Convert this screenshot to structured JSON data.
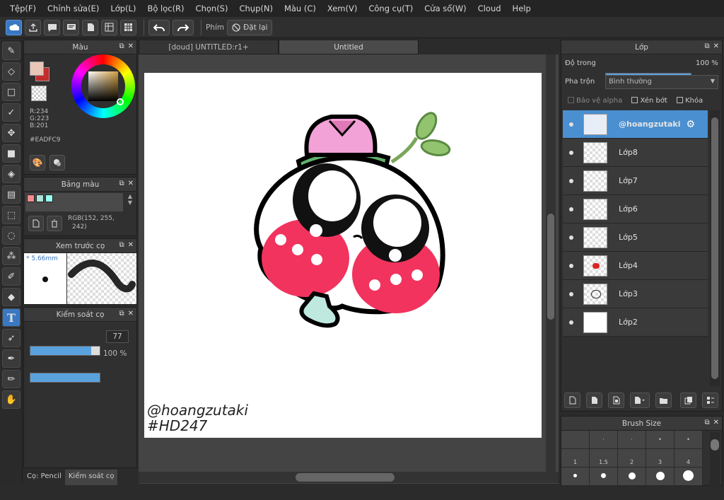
{
  "menu": [
    "Tệp(F)",
    "Chỉnh sửa(E)",
    "Lớp(L)",
    "Bộ lọc(R)",
    "Chọn(S)",
    "Chụp(N)",
    "Màu (C)",
    "Xem(V)",
    "Công cụ(T)",
    "Cửa sổ(W)",
    "Cloud",
    "Help"
  ],
  "toolbar": {
    "key_label": "Phím",
    "reset_label": "Đặt lại"
  },
  "color_panel": {
    "title": "Màu",
    "r": "R:234",
    "g": "G:223",
    "b": "B:201",
    "hex": "#EADFC9",
    "fg_color": "#e8c7b9",
    "bg_color": "#c22d2d"
  },
  "palette_panel": {
    "title": "Bảng màu",
    "rgb": "RGB(152, 255,",
    "rgb2": "242)",
    "swatches": [
      "#f28b8b",
      "#a9e3d9",
      "#98fff2"
    ]
  },
  "brush_preview": {
    "title": "Xem trước cọ",
    "size": "* 5.66mm"
  },
  "brush_control": {
    "title": "Kiểm soát cọ",
    "size_value": "77",
    "size_fill": 0.88,
    "opacity_value": "100 %",
    "opacity_fill": 1.0
  },
  "bottom_tabs": {
    "pencil": "Cọ: Pencil",
    "control": "Kiểm soát cọ"
  },
  "tabs": [
    "[doud] UNTITLED:r1+",
    "Untitled"
  ],
  "canvas": {
    "watermark1": "@hoangzutaki",
    "watermark2": "#HD247"
  },
  "layer_panel": {
    "title": "Lớp",
    "opacity_label": "Độ trong",
    "opacity_value": "100 %",
    "blend_label": "Pha trộn",
    "blend_value": "Bình thường",
    "protect_alpha": "Bảo vệ alpha",
    "clip": "Xén bớt",
    "lock": "Khóa"
  },
  "layers": [
    {
      "name": "@hoangzutaki",
      "selected": true
    },
    {
      "name": "Lớp8"
    },
    {
      "name": "Lớp7"
    },
    {
      "name": "Lớp6"
    },
    {
      "name": "Lớp5"
    },
    {
      "name": "Lớp4"
    },
    {
      "name": "Lớp3"
    },
    {
      "name": "Lớp2"
    }
  ],
  "brush_size_panel": {
    "title": "Brush Size",
    "row1": [
      "1",
      "1.5",
      "2",
      "3",
      "4"
    ]
  }
}
